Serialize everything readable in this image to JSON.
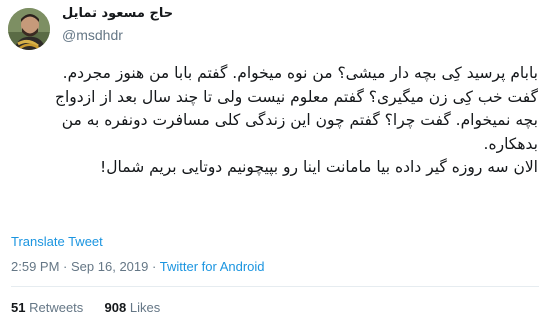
{
  "author": {
    "display_name": "حاج مسعود تمایل",
    "handle": "@msdhdr",
    "avatar_icon": "profile-photo"
  },
  "tweet": {
    "lines": [
      "بابام پرسید کِی بچه دار میشی؟ من نوه میخوام. گفتم بابا من هنوز مجردم.",
      "گفت خب کِی زن میگیری؟ گفتم معلوم نیست ولی تا چند سال بعد از ازدواج",
      "بچه نمیخوام. گفت چرا؟ گفتم چون این زندگی کلی مسافرت دونفره به من",
      "بدهکاره.",
      "الان سه روزه گیر داده بیا مامانت اینا رو بپیچونیم دوتایی بریم شمال!"
    ]
  },
  "translate_label": "Translate Tweet",
  "meta": {
    "time": "2:59 PM",
    "separator": "·",
    "date": "Sep 16, 2019",
    "source": "Twitter for Android"
  },
  "stats": {
    "retweets_count": "51",
    "retweets_label": "Retweets",
    "likes_count": "908",
    "likes_label": "Likes"
  },
  "colors": {
    "link": "#1b95e0",
    "secondary_text": "#657786",
    "primary_text": "#14171a",
    "divider": "#e6ecf0"
  }
}
